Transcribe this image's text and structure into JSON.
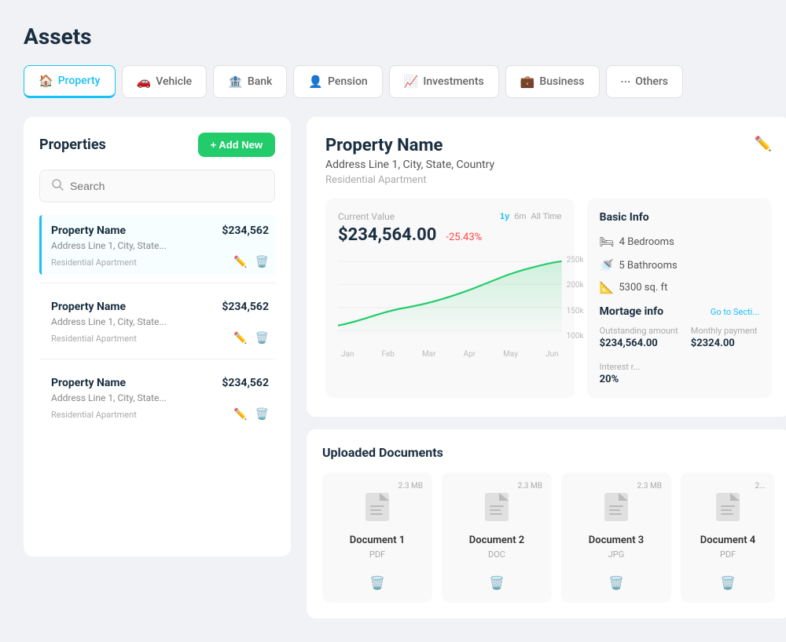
{
  "page": {
    "title": "Assets"
  },
  "tabs": [
    {
      "id": "property",
      "label": "Property",
      "icon": "🏠",
      "active": true
    },
    {
      "id": "vehicle",
      "label": "Vehicle",
      "icon": "🚗",
      "active": false
    },
    {
      "id": "bank",
      "label": "Bank",
      "icon": "🏦",
      "active": false
    },
    {
      "id": "pension",
      "label": "Pension",
      "icon": "👤",
      "active": false
    },
    {
      "id": "investments",
      "label": "Investments",
      "icon": "📈",
      "active": false
    },
    {
      "id": "business",
      "label": "Business",
      "icon": "💼",
      "active": false
    },
    {
      "id": "others",
      "label": "Others",
      "icon": "···",
      "active": false
    }
  ],
  "leftPanel": {
    "title": "Properties",
    "addButtonLabel": "+ Add New",
    "searchPlaceholder": "Search",
    "properties": [
      {
        "name": "Property Name",
        "address": "Address Line 1, City, State...",
        "type": "Residential Apartment",
        "value": "$234,562",
        "selected": true
      },
      {
        "name": "Property Name",
        "address": "Address Line 1, City, State...",
        "type": "Residential Apartment",
        "value": "$234,562",
        "selected": false
      },
      {
        "name": "Property Name",
        "address": "Address Line 1, City, State...",
        "type": "Residential Apartment",
        "value": "$234,562",
        "selected": false
      }
    ]
  },
  "detail": {
    "propertyName": "Property Name",
    "address": "Address Line 1, City, State, Country",
    "type": "Residential Apartment",
    "chart": {
      "label": "Current Value",
      "value": "$234,564.00",
      "change": "-25.43%",
      "timeBtns": [
        "1y",
        "6m",
        "All Time"
      ],
      "activeTimeBtn": "1y",
      "yLabels": [
        "250k",
        "200k",
        "150k",
        "100k"
      ],
      "xLabels": [
        "Jan",
        "Feb",
        "Mar",
        "Apr",
        "May",
        "Jun"
      ]
    },
    "basicInfo": {
      "title": "Basic Info",
      "bedrooms": "4 Bedrooms",
      "bathrooms": "5 Bathrooms",
      "area": "5300 sq. ft",
      "mortgageTitle": "Mortage info",
      "goToSection": "Go to Secti...",
      "outstandingLabel": "Outstanding amount",
      "outstandingValue": "$234,564.00",
      "monthlyLabel": "Monthly payment",
      "monthlyValue": "$2324.00",
      "interestLabel": "Interest r...",
      "interestValue": "20%"
    }
  },
  "documents": {
    "title": "Uploaded Documents",
    "items": [
      {
        "name": "Document 1",
        "type": "PDF",
        "size": "2.3 MB"
      },
      {
        "name": "Document 2",
        "type": "DOC",
        "size": "2.3 MB"
      },
      {
        "name": "Document 3",
        "type": "JPG",
        "size": "2.3 MB"
      },
      {
        "name": "Document 4",
        "type": "PDF",
        "size": "2..."
      }
    ]
  }
}
